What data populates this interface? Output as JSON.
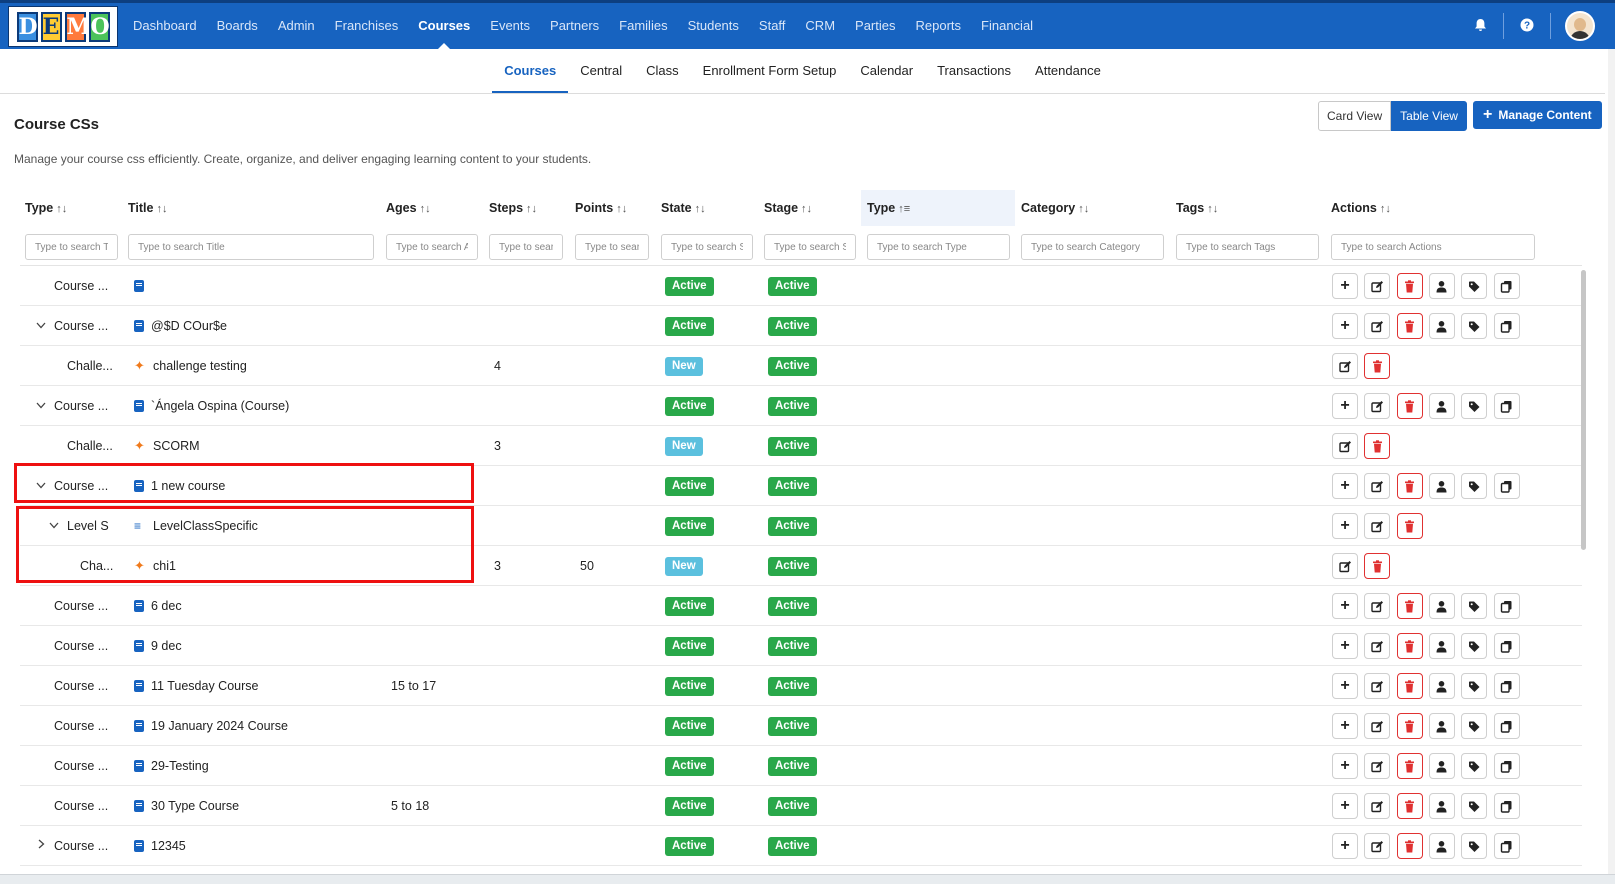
{
  "brand": {
    "logo_letters": [
      "D",
      "E",
      "M",
      "O"
    ]
  },
  "nav": {
    "items": [
      "Dashboard",
      "Boards",
      "Admin",
      "Franchises",
      "Courses",
      "Events",
      "Partners",
      "Families",
      "Students",
      "Staff",
      "CRM",
      "Parties",
      "Reports",
      "Financial"
    ],
    "active": "Courses"
  },
  "subnav": {
    "items": [
      "Courses",
      "Central",
      "Class",
      "Enrollment Form Setup",
      "Calendar",
      "Transactions",
      "Attendance"
    ],
    "active": "Courses"
  },
  "page": {
    "title": "Course CSs",
    "description": "Manage your course css efficiently. Create, organize, and deliver engaging learning content to your students."
  },
  "view_toggle": {
    "card": "Card View",
    "table": "Table View",
    "active": "Table View"
  },
  "manage_button": "Manage Content",
  "icons": {
    "bell": "bell-icon",
    "help": "help-icon",
    "sort": "sort-icon",
    "add": "plus-icon",
    "edit": "edit-icon",
    "delete": "trash-icon",
    "user": "user-icon",
    "tag": "tag-icon",
    "copy": "copy-icon"
  },
  "colors": {
    "primary": "#1763c0",
    "active_badge": "#29a84a",
    "new_badge": "#5bc0de",
    "delete": "#e03131",
    "highlight_box": "#ee1010"
  },
  "table": {
    "columns": [
      "Type",
      "Title",
      "Ages",
      "Steps",
      "Points",
      "State",
      "Stage",
      "Type",
      "Category",
      "Tags",
      "Actions"
    ],
    "filters": [
      "Type to search T",
      "Type to search Title",
      "Type to search A",
      "Type to sear",
      "Type to sear",
      "Type to search S",
      "Type to search S",
      "Type to search Type",
      "Type to search Category",
      "Type to search Tags",
      "Type to search Actions"
    ],
    "rows": [
      {
        "type": "Course ...",
        "title": "",
        "ages": "",
        "steps": "",
        "points": "",
        "state": "Active",
        "stage": "Active",
        "level": 0,
        "chevron": "",
        "icon": "book"
      },
      {
        "type": "Course ...",
        "title": "@$D COur$e",
        "ages": "",
        "steps": "",
        "points": "",
        "state": "Active",
        "stage": "Active",
        "level": 0,
        "chevron": "down",
        "icon": "book"
      },
      {
        "type": "Challe...",
        "title": "challenge testing",
        "ages": "",
        "steps": "4",
        "points": "",
        "state": "New",
        "stage": "Active",
        "level": 1,
        "chevron": "",
        "icon": "puzzle"
      },
      {
        "type": "Course ...",
        "title": "`Ángela Ospina (Course)",
        "ages": "",
        "steps": "",
        "points": "",
        "state": "Active",
        "stage": "Active",
        "level": 0,
        "chevron": "down",
        "icon": "book"
      },
      {
        "type": "Challe...",
        "title": "SCORM",
        "ages": "",
        "steps": "3",
        "points": "",
        "state": "New",
        "stage": "Active",
        "level": 1,
        "chevron": "",
        "icon": "puzzle"
      },
      {
        "type": "Course ...",
        "title": "1 new course",
        "ages": "",
        "steps": "",
        "points": "",
        "state": "Active",
        "stage": "Active",
        "level": 0,
        "chevron": "down",
        "icon": "book"
      },
      {
        "type": "Level S",
        "title": "LevelClassSpecific",
        "ages": "",
        "steps": "",
        "points": "",
        "state": "Active",
        "stage": "Active",
        "level": 1,
        "chevron": "down",
        "icon": "layers"
      },
      {
        "type": "Cha...",
        "title": "chi1",
        "ages": "",
        "steps": "3",
        "points": "50",
        "state": "New",
        "stage": "Active",
        "level": 2,
        "chevron": "",
        "icon": "puzzle"
      },
      {
        "type": "Course ...",
        "title": "6 dec",
        "ages": "",
        "steps": "",
        "points": "",
        "state": "Active",
        "stage": "Active",
        "level": 0,
        "chevron": "",
        "icon": "book"
      },
      {
        "type": "Course ...",
        "title": "9 dec",
        "ages": "",
        "steps": "",
        "points": "",
        "state": "Active",
        "stage": "Active",
        "level": 0,
        "chevron": "",
        "icon": "book"
      },
      {
        "type": "Course ...",
        "title": "11 Tuesday Course",
        "ages": "15 to 17",
        "steps": "",
        "points": "",
        "state": "Active",
        "stage": "Active",
        "level": 0,
        "chevron": "",
        "icon": "book"
      },
      {
        "type": "Course ...",
        "title": "19 January 2024 Course",
        "ages": "",
        "steps": "",
        "points": "",
        "state": "Active",
        "stage": "Active",
        "level": 0,
        "chevron": "",
        "icon": "book"
      },
      {
        "type": "Course ...",
        "title": "29-Testing",
        "ages": "",
        "steps": "",
        "points": "",
        "state": "Active",
        "stage": "Active",
        "level": 0,
        "chevron": "",
        "icon": "book"
      },
      {
        "type": "Course ...",
        "title": "30 Type Course",
        "ages": "5 to 18",
        "steps": "",
        "points": "",
        "state": "Active",
        "stage": "Active",
        "level": 0,
        "chevron": "",
        "icon": "book"
      },
      {
        "type": "Course ...",
        "title": "12345",
        "ages": "",
        "steps": "",
        "points": "",
        "state": "Active",
        "stage": "Active",
        "level": 0,
        "chevron": "right",
        "icon": "book"
      }
    ]
  }
}
